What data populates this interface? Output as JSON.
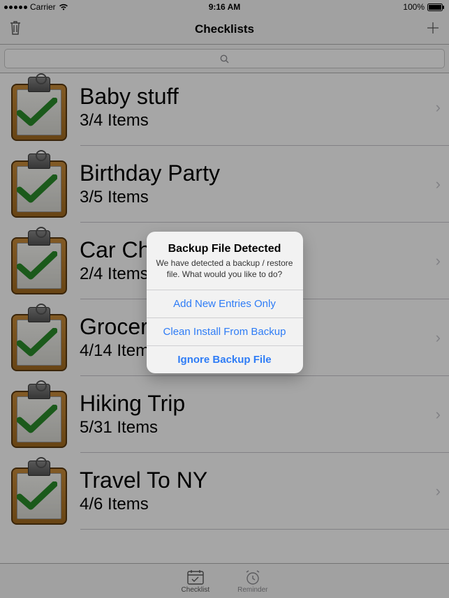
{
  "status": {
    "carrier": "Carrier",
    "time": "9:16 AM",
    "battery": "100%"
  },
  "nav": {
    "title": "Checklists"
  },
  "search": {
    "placeholder": ""
  },
  "rows": [
    {
      "title": "Baby stuff",
      "sub": "3/4 Items"
    },
    {
      "title": "Birthday Party",
      "sub": "3/5 Items"
    },
    {
      "title": "Car Checkup",
      "sub": "2/4 Items"
    },
    {
      "title": "Groceries",
      "sub": "4/14 Items"
    },
    {
      "title": "Hiking Trip",
      "sub": "5/31 Items"
    },
    {
      "title": "Travel To NY",
      "sub": "4/6 Items"
    }
  ],
  "tabs": {
    "checklist": "Checklist",
    "reminder": "Reminder"
  },
  "alert": {
    "title": "Backup File Detected",
    "message": "We have detected a backup / restore file. What would you like to do?",
    "btn1": "Add New Entries Only",
    "btn2": "Clean Install From Backup",
    "btn3": "Ignore Backup File"
  }
}
